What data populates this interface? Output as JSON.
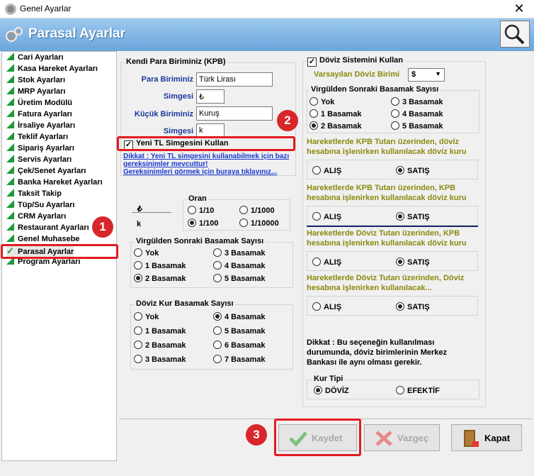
{
  "window": {
    "title": "Genel Ayarlar"
  },
  "header": {
    "title": "Parasal Ayarlar"
  },
  "sidebar": {
    "items": [
      "Cari Ayarları",
      "Kasa Hareket Ayarları",
      "Stok Ayarları",
      "MRP Ayarları",
      "Üretim Modülü",
      "Fatura Ayarları",
      "İrsaliye Ayarları",
      "Teklif Ayarları",
      "Sipariş Ayarları",
      "Servis Ayarları",
      "Çek/Senet Ayarları",
      "Banka Hareket Ayarları",
      "Taksit Takip",
      "Tüp/Su Ayarları",
      "CRM Ayarları",
      "Restaurant Ayarları",
      "Genel Muhasebe",
      "Parasal Ayarlar",
      "Program Ayarları"
    ],
    "selected": "Parasal Ayarlar"
  },
  "kpb": {
    "group_title": "Kendi Para Biriminiz (KPB)",
    "para_birimi_label": "Para Biriminiz",
    "para_birimi_value": "Türk Lirası",
    "simge_label": "Simgesi",
    "simge_value": "₺",
    "kucuk_label": "Küçük Biriminiz",
    "kucuk_value": "Kuruş",
    "kucuk_simge_label": "Simgesi",
    "kucuk_simge_value": "k",
    "yeni_tl_label": "Yeni TL Simgesini Kullan",
    "dikkat_link1": "Dikkat : Yeni TL simgesini kullanabilmek için bazı gereksinimler mevcuttur!",
    "dikkat_link2": "Gereksinimleri görmek için buraya tıklayınız..."
  },
  "oran": {
    "title": "Oran",
    "symbols": [
      "₺",
      "k"
    ],
    "options": [
      "1/10",
      "1/1000",
      "1/100",
      "1/10000"
    ],
    "selected": "1/100"
  },
  "kpb_decimals": {
    "title": "Virgülden Sonraki Basamak Sayısı",
    "options": [
      "Yok",
      "3 Basamak",
      "1 Basamak",
      "4 Basamak",
      "2 Basamak",
      "5 Basamak"
    ],
    "selected": "2 Basamak"
  },
  "kur_decimals": {
    "title": "Döviz Kur Basamak Sayısı",
    "options": [
      "Yok",
      "4 Basamak",
      "1 Basamak",
      "5 Basamak",
      "2 Basamak",
      "6 Basamak",
      "3 Basamak",
      "7 Basamak"
    ],
    "selected": "4 Basamak"
  },
  "doviz": {
    "enable_label": "Döviz Sistemini Kullan",
    "default_label": "Varsayılan Döviz Birimi",
    "default_value": "$",
    "decimals_title": "Virgülden Sonraki Basamak Sayısı",
    "decimals_options": [
      "Yok",
      "3 Basamak",
      "1 Basamak",
      "4 Basamak",
      "2 Basamak",
      "5 Basamak"
    ],
    "decimals_selected": "2 Basamak",
    "sections": [
      {
        "text": "Hareketlerde KPB Tutarı üzerinden, döviz hesabına işlenirken kullanılacak döviz kuru",
        "buy": "ALIŞ",
        "sell": "SATIŞ"
      },
      {
        "text": "Hareketlerde KPB Tutarı üzerinden, KPB hesabına işlenirken kullanılacak döviz kuru",
        "buy": "ALIŞ",
        "sell": "SATIŞ"
      },
      {
        "text": "Hareketlerde Döviz Tutarı üzerinden, KPB hesabına işlenirken kullanılacak döviz kuru",
        "buy": "ALIŞ",
        "sell": "SATIŞ"
      },
      {
        "text": "Hareketlerde Döviz Tutarı üzerinden, Döviz hesabına işlenirken kullanılacak...",
        "buy": "ALIŞ",
        "sell": "SATIŞ"
      }
    ],
    "note": "Dikkat : Bu seçeneğin kullanılması durumunda, döviz birimlerinin Merkez Bankası ile aynı olması gerekir.",
    "kur_tipi_title": "Kur Tipi",
    "kur_tipi_options": [
      "DÖVİZ",
      "EFEKTİF"
    ],
    "kur_tipi_selected": "DÖVİZ"
  },
  "buttons": {
    "save": "Kaydet",
    "cancel": "Vazgeç",
    "close": "Kapat"
  },
  "badges": [
    "1",
    "2",
    "3"
  ],
  "colors": {
    "header": "#6aa6dc",
    "highlight": "#e21b22",
    "link": "#1a3ad0",
    "olive": "#8a8a10"
  }
}
